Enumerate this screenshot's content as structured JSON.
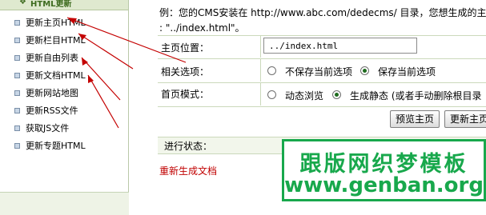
{
  "sidebar": {
    "header_label": "HTML更新",
    "items": [
      {
        "label": "更新主页HTML"
      },
      {
        "label": "更新栏目HTML"
      },
      {
        "label": "更新自由列表"
      },
      {
        "label": "更新文档HTML"
      },
      {
        "label": "更新网站地图"
      },
      {
        "label": "更新RSS文件"
      },
      {
        "label": "获取JS文件"
      },
      {
        "label": "更新专题HTML"
      }
    ]
  },
  "main": {
    "info_line1": "例：您的CMS安装在 http://www.abc.com/dedecms/ 目录，您想生成的主页为",
    "info_line2": ": \"../index.html\"。",
    "homepage_position": {
      "label": "主页位置：",
      "value": "../index.html"
    },
    "related_options": {
      "label": "相关选项：",
      "options": [
        {
          "label": "不保存当前选项",
          "checked": false
        },
        {
          "label": "保存当前选项",
          "checked": true
        }
      ]
    },
    "homepage_mode": {
      "label": "首页模式：",
      "options": [
        {
          "label": "动态浏览",
          "checked": false
        },
        {
          "label": "生成静态 (或者手动删除根目录",
          "checked": true
        }
      ]
    },
    "buttons": {
      "preview": "预览主页",
      "update": "更新主页"
    },
    "progress_label": "进行状态：",
    "status_message": "重新生成文档"
  },
  "watermark": {
    "line1": "跟版网织梦模板",
    "line2": "www.genban.org"
  },
  "colors": {
    "watermark_green": "#18a84c",
    "arrow_red": "#c40000",
    "status_red": "#c00000"
  }
}
